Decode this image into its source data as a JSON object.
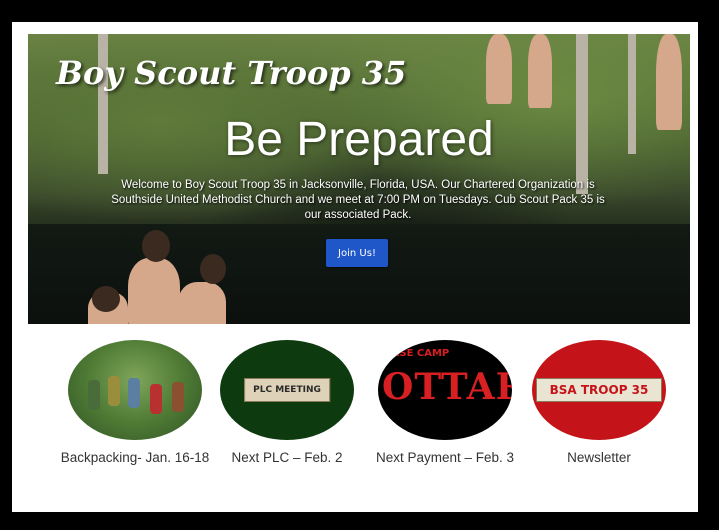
{
  "hero": {
    "brand": "Boy Scout Troop 35",
    "headline": "Be Prepared",
    "intro": "Welcome to Boy Scout Troop 35 in Jacksonville, Florida, USA. Our Chartered Organization is Southside United Methodist Church and we meet at 7:00 PM on Tuesdays. Cub Scout Pack 35 is our associated Pack.",
    "join_button": "Join Us!"
  },
  "cards": [
    {
      "label": "Backpacking- Jan. 16-18",
      "image_icon": "backpacking-photo"
    },
    {
      "label": "Next PLC – Feb. 2",
      "image_icon": "plc-meeting-sign",
      "image_text": "PLC MEETING"
    },
    {
      "label": "Next Payment – Feb. 3",
      "image_icon": "base-camp-ottari-sign",
      "image_text_top": "BASE CAMP",
      "image_text_big": "OTTARI"
    },
    {
      "label": "Newsletter",
      "image_icon": "bsa-troop-35-sign",
      "image_text": "BSA TROOP 35"
    }
  ],
  "colors": {
    "button": "#1f56c8",
    "accent_red": "#c4141a",
    "dark_green": "#0e3a0f"
  }
}
